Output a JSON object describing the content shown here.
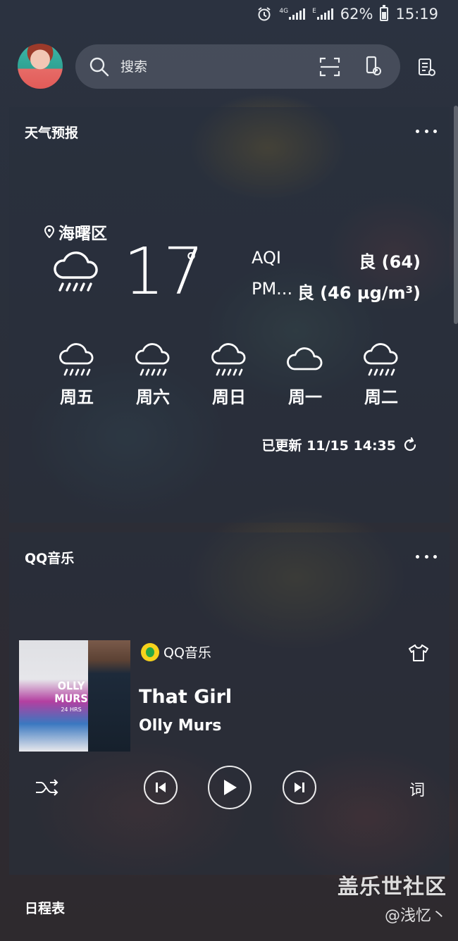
{
  "status_bar": {
    "alarm_icon": "alarm-clock-icon",
    "network_type": "4G",
    "network_type_2": "E",
    "battery": "62%",
    "time": "15:19"
  },
  "search": {
    "placeholder": "搜索",
    "icons": [
      "search-icon",
      "scan-icon",
      "voice-icon",
      "settings-list-icon"
    ]
  },
  "weather_card": {
    "title": "天气预报",
    "location": "海曙区",
    "temperature": "17",
    "degree": "°",
    "aqi_label": "AQI",
    "aqi_value": "良 (64)",
    "pm_label": "PM...",
    "pm_value": "良 (46 µg/m³)",
    "forecast": [
      {
        "day": "周五",
        "icon": "rain-icon"
      },
      {
        "day": "周六",
        "icon": "rain-icon"
      },
      {
        "day": "周日",
        "icon": "rain-icon"
      },
      {
        "day": "周一",
        "icon": "cloud-icon"
      },
      {
        "day": "周二",
        "icon": "rain-icon"
      }
    ],
    "updated": "已更新 11/15 14:35"
  },
  "music_card": {
    "title": "QQ音乐",
    "brand": "QQ音乐",
    "album_text": "OLLY MURS",
    "album_sub": "24 HRS",
    "song_title": "That Girl",
    "artist": "Olly Murs",
    "lyrics_label": "词"
  },
  "schedule": {
    "title": "日程表"
  },
  "watermark": {
    "main": "盖乐世社区",
    "sub": "@浅忆丶"
  },
  "colors": {
    "text": "#ffffff",
    "card_bg": "#28303c",
    "qq_yellow": "#f6d21c",
    "qq_green": "#28a745"
  }
}
